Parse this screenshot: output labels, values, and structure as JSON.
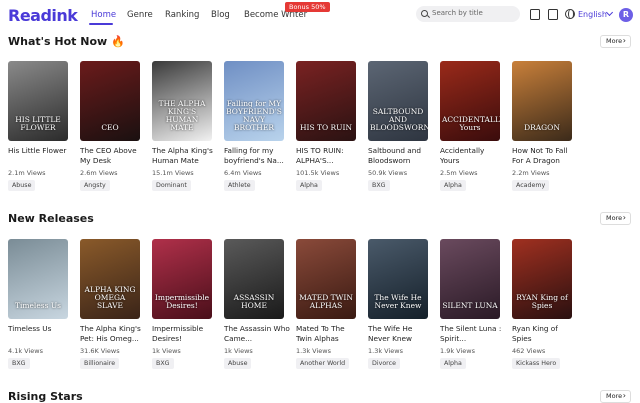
{
  "header": {
    "logo": "Readink",
    "nav": [
      {
        "label": "Home"
      },
      {
        "label": "Genre"
      },
      {
        "label": "Ranking"
      },
      {
        "label": "Blog"
      },
      {
        "label": "Become Writer"
      }
    ],
    "bonus_badge": "Bonus 50%",
    "search_placeholder": "Search by title",
    "language": "English",
    "avatar_initial": "R",
    "accent_color": "#4a3ad8"
  },
  "sections": [
    {
      "title": "What's Hot Now 🔥",
      "more_label": "More",
      "books": [
        {
          "title": "His Little Flower",
          "views": "2.1m Views",
          "tag": "Abuse",
          "cover_text": "HIS LITTLE FLOWER",
          "colors": [
            "#2b2b2b",
            "#8a8a8a"
          ]
        },
        {
          "title": "The CEO Above My Desk",
          "views": "2.6m Views",
          "tag": "Angsty",
          "cover_text": "CEO",
          "colors": [
            "#1a1010",
            "#6b1b1b"
          ]
        },
        {
          "title": "The Alpha King's Human Mate",
          "views": "15.1m Views",
          "tag": "Dominant",
          "cover_text": "THE ALPHA KING'S HUMAN MATE",
          "colors": [
            "#f2f2f2",
            "#3a3a3a"
          ]
        },
        {
          "title": "Falling for my boyfriend's Na...",
          "views": "6.4m Views",
          "tag": "Athlete",
          "cover_text": "Falling for MY BOYFRIEND'S NAVY BROTHER",
          "colors": [
            "#b9d3ec",
            "#6f8fc4"
          ]
        },
        {
          "title": "HIS TO RUIN: ALPHA'S...",
          "views": "101.5k Views",
          "tag": "Alpha",
          "cover_text": "HIS TO RUIN",
          "colors": [
            "#2a1212",
            "#7a2222"
          ]
        },
        {
          "title": "Saltbound and Bloodsworn",
          "views": "50.9k Views",
          "tag": "BXG",
          "cover_text": "SALTBOUND AND BLOODSWORN",
          "colors": [
            "#2e3540",
            "#5c6674"
          ]
        },
        {
          "title": "Accidentally Yours",
          "views": "2.5m Views",
          "tag": "Alpha",
          "cover_text": "ACCIDENTALLY Yours",
          "colors": [
            "#3a0c0c",
            "#9a2a1a"
          ]
        },
        {
          "title": "How Not To Fall For A Dragon",
          "views": "2.2m Views",
          "tag": "Academy",
          "cover_text": "DRAGON",
          "colors": [
            "#3b2a1a",
            "#c9803a"
          ]
        }
      ]
    },
    {
      "title": "New Releases",
      "more_label": "More",
      "books": [
        {
          "title": "Timeless Us",
          "views": "4.1k Views",
          "tag": "BXG",
          "cover_text": "Timeless Us",
          "colors": [
            "#c8d6e0",
            "#7a8c96"
          ]
        },
        {
          "title": "The Alpha King's Pet: His Omeg...",
          "views": "31.6K Views",
          "tag": "Billionaire",
          "cover_text": "ALPHA KING OMEGA SLAVE",
          "colors": [
            "#3a2418",
            "#8a5a2a"
          ]
        },
        {
          "title": "Impermissible Desires!",
          "views": "1k Views",
          "tag": "BXG",
          "cover_text": "Impermissible Desires!",
          "colors": [
            "#4a0f1a",
            "#b0304a"
          ]
        },
        {
          "title": "The Assassin Who Came...",
          "views": "1k Views",
          "tag": "Abuse",
          "cover_text": "ASSASSIN HOME",
          "colors": [
            "#1a1a1a",
            "#5a5a5a"
          ]
        },
        {
          "title": "Mated To The Twin Alphas",
          "views": "1.3k Views",
          "tag": "Another World",
          "cover_text": "MATED TWIN ALPHAS",
          "colors": [
            "#3a1a12",
            "#8a4a3a"
          ]
        },
        {
          "title": "The Wife He Never Knew",
          "views": "1.3k Views",
          "tag": "Divorce",
          "cover_text": "The Wife He Never Knew",
          "colors": [
            "#15202a",
            "#4a5a6a"
          ]
        },
        {
          "title": "The Silent Luna : Spirit...",
          "views": "1.9k Views",
          "tag": "Alpha",
          "cover_text": "SILENT LUNA",
          "colors": [
            "#2a1a26",
            "#6a4a5e"
          ]
        },
        {
          "title": "Ryan King of Spies",
          "views": "462 Views",
          "tag": "Kickass Hero",
          "cover_text": "RYAN King of Spies",
          "colors": [
            "#2a1010",
            "#a03020"
          ]
        }
      ]
    },
    {
      "title": "Rising Stars",
      "more_label": "More",
      "books": []
    }
  ]
}
